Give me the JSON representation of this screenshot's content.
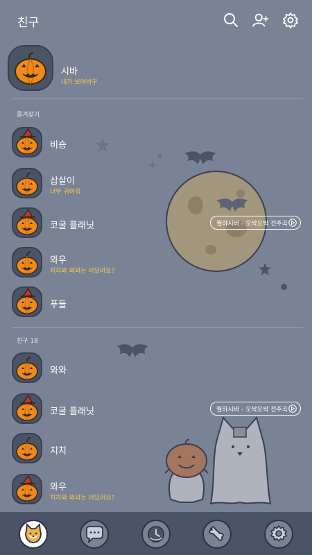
{
  "header": {
    "title": "친구",
    "icons": [
      "search-icon",
      "add-friend-icon",
      "settings-icon"
    ]
  },
  "profile": {
    "name": "시바",
    "status": "내가 보여바꾸"
  },
  "favorites": {
    "label": "즐겨찾기",
    "items": [
      {
        "name": "비숑",
        "status": "",
        "hat": true
      },
      {
        "name": "삽살이",
        "status": "너무 귀여워",
        "hat": false
      },
      {
        "name": "코굴 플래닛",
        "status": "",
        "hat": true
      },
      {
        "name": "와우",
        "status": "치치와 와와는 어딨어요?",
        "hat": false
      },
      {
        "name": "푸들",
        "status": "",
        "hat": true
      }
    ],
    "music": "월하시바 - 오싹오싹 전주곡"
  },
  "friends": {
    "label": "친구 18",
    "items": [
      {
        "name": "와와",
        "status": "",
        "hat": false
      },
      {
        "name": "코굴 플래닛",
        "status": "",
        "hat": true
      },
      {
        "name": "치치",
        "status": "",
        "hat": false
      },
      {
        "name": "와우",
        "status": "치치와 와와는 어딨어요?",
        "hat": true
      }
    ],
    "music": "월하시바 - 오싹오싹 전주곡"
  },
  "bottom_nav": [
    {
      "icon": "shiba-face-icon",
      "active": true
    },
    {
      "icon": "chat-bubble-icon",
      "active": false
    },
    {
      "icon": "clock-icon",
      "active": false
    },
    {
      "icon": "bone-icon",
      "active": false
    },
    {
      "icon": "gear-icon",
      "active": false
    }
  ],
  "colors": {
    "background": "#7a8396",
    "nav_bar": "#4b5366",
    "status_text": "#f2c94c",
    "pumpkin": "#f08a1c",
    "moon": "#a2977d"
  }
}
